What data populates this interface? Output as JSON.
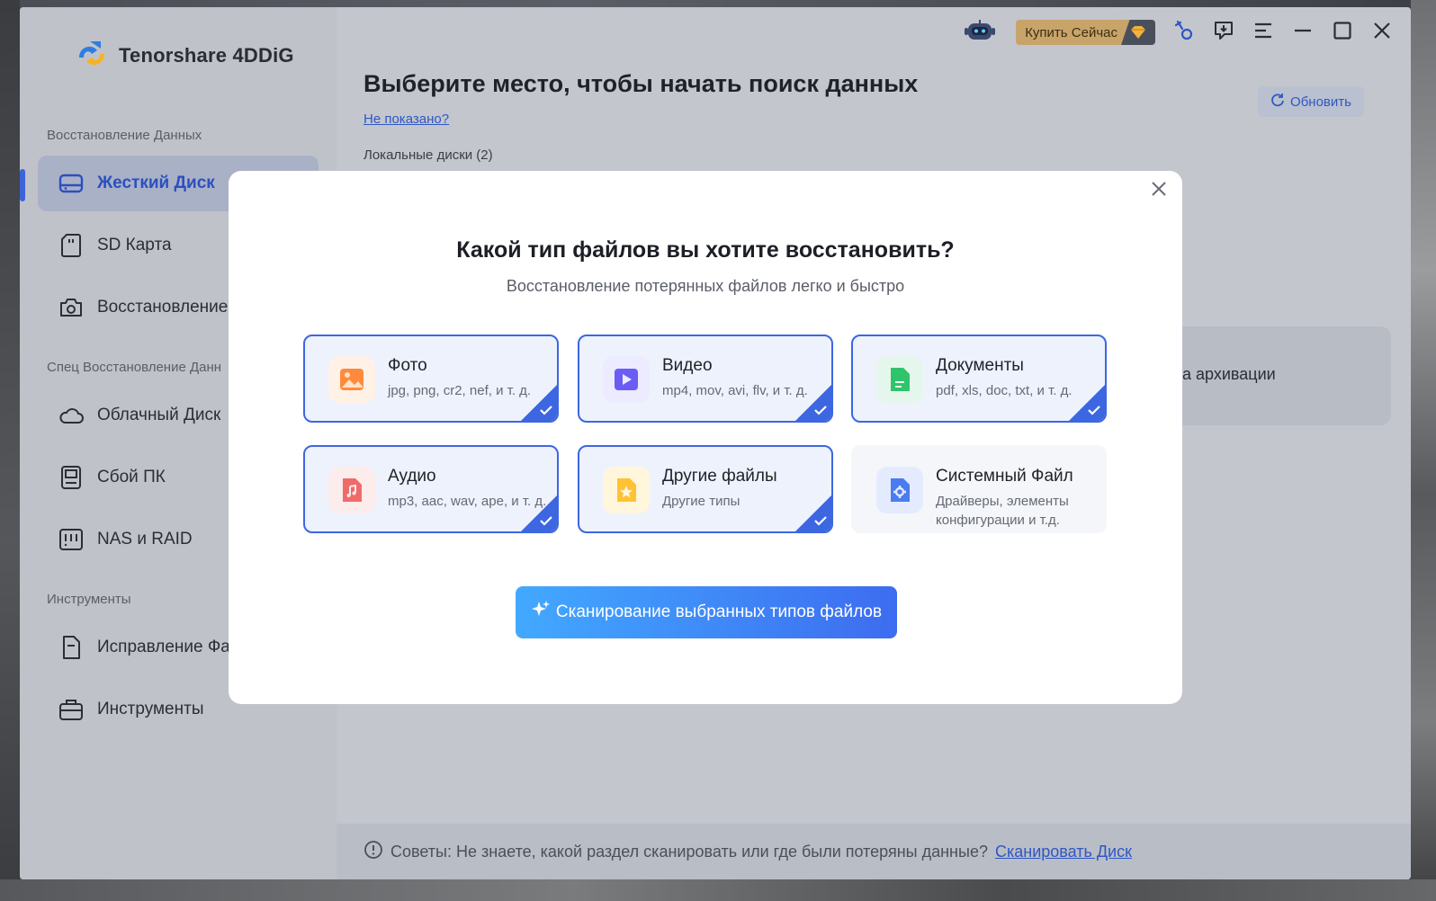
{
  "app": {
    "name": "Tenorshare 4DDiG"
  },
  "titlebar": {
    "buy_label": "Купить Сейчас"
  },
  "sidebar": {
    "section_recovery": "Восстановление Данных",
    "section_special": "Спец Восстановление Данн",
    "section_tools": "Инструменты",
    "items": [
      {
        "label": "Жесткий Диск",
        "icon": "hard-drive-icon",
        "active": true
      },
      {
        "label": "SD Карта",
        "icon": "sd-card-icon"
      },
      {
        "label": "Восстановление I",
        "icon": "camera-icon"
      },
      {
        "label": "Облачный Диск",
        "icon": "cloud-icon"
      },
      {
        "label": "Сбой ПК",
        "icon": "pc-crash-icon"
      },
      {
        "label": "NAS и RAID",
        "icon": "nas-icon"
      },
      {
        "label": "Исправление Фа",
        "icon": "file-repair-icon"
      },
      {
        "label": "Инструменты",
        "icon": "toolbox-icon"
      }
    ]
  },
  "main": {
    "title": "Выберите место, чтобы начать поиск данных",
    "not_shown": "Не показано?",
    "local_disks": "Локальные диски (2)",
    "refresh": "Обновить",
    "bg_card_text": "а архивации",
    "tips_prefix": "Советы: Не знаете, какой раздел сканировать или где были потеряны данные?",
    "tips_link": "Сканировать Диск"
  },
  "modal": {
    "title": "Какой тип файлов вы хотите восстановить?",
    "subtitle": "Восстановление потерянных файлов легко и быстро",
    "file_types": [
      {
        "name": "Фото",
        "desc": "jpg, png, cr2, nef, и т. д.",
        "selected": true,
        "icon": "photo-icon",
        "color": "#ff8a3d"
      },
      {
        "name": "Видео",
        "desc": "mp4, mov, avi, flv, и т. д.",
        "selected": true,
        "icon": "video-icon",
        "color": "#6a5cf5"
      },
      {
        "name": "Документы",
        "desc": "pdf, xls, doc, txt, и т. д.",
        "selected": true,
        "icon": "document-icon",
        "color": "#2fc46b"
      },
      {
        "name": "Аудио",
        "desc": "mp3, aac, wav, ape, и т. д.",
        "selected": true,
        "icon": "audio-icon",
        "color": "#f06a6a"
      },
      {
        "name": "Другие файлы",
        "desc": "Другие типы",
        "selected": true,
        "icon": "other-files-icon",
        "color": "#ffc234"
      },
      {
        "name": "Системный Файл",
        "desc": "Драйверы, элементы конфигурации и т.д.",
        "selected": false,
        "icon": "system-file-icon",
        "color": "#4a7cf0"
      }
    ],
    "scan_button": "Сканирование выбранных типов файлов"
  }
}
